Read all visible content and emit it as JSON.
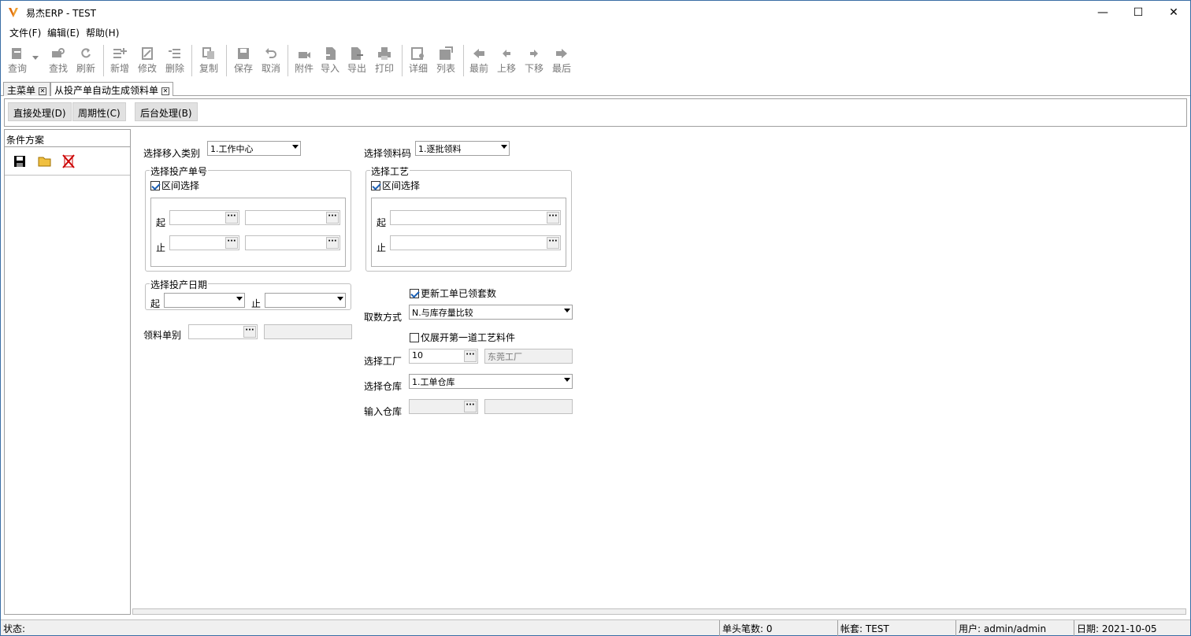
{
  "window": {
    "title": "易杰ERP - TEST",
    "minimize": "—",
    "maximize": "☐",
    "close": "✕"
  },
  "menu": [
    "文件(F)",
    "编辑(E)",
    "帮助(H)"
  ],
  "toolbar": {
    "query": "查询",
    "find": "查找",
    "refresh": "刷新",
    "add": "新增",
    "edit": "修改",
    "delete": "删除",
    "copy": "复制",
    "save": "保存",
    "cancel": "取消",
    "attach": "附件",
    "import": "导入",
    "export": "导出",
    "print": "打印",
    "detail": "详细",
    "list": "列表",
    "first": "最前",
    "up": "上移",
    "down": "下移",
    "last": "最后"
  },
  "tabs": [
    {
      "label": "主菜单"
    },
    {
      "label": "从投产单自动生成领料单"
    }
  ],
  "actions": {
    "direct": "直接处理(D)",
    "periodic": "周期性(C)",
    "background": "后台处理(B)"
  },
  "left_panel": {
    "header": "条件方案"
  },
  "form": {
    "move_type_label": "选择移入类别",
    "move_type_value": "1.工作中心",
    "pick_code_label": "选择领料码",
    "pick_code_value": "1.逐批领料",
    "order_group": "选择投产单号",
    "range_select": "区间选择",
    "from": "起",
    "to": "止",
    "process_group": "选择工艺",
    "date_group": "选择投产日期",
    "pick_doc_label": "领料单别",
    "update_check": "更新工单已领套数",
    "fetch_label": "取数方式",
    "fetch_value": "N.与库存量比较",
    "expand_check": "仅展开第一道工艺料件",
    "factory_label": "选择工厂",
    "factory_code": "10",
    "factory_name": "东莞工厂",
    "warehouse_label": "选择仓库",
    "warehouse_value": "1.工单仓库",
    "in_warehouse_label": "输入仓库"
  },
  "status": {
    "state": "状态:",
    "count": "单头笔数: 0",
    "account": "帐套: TEST",
    "user": "用户: admin/admin",
    "date": "日期: 2021-10-05"
  },
  "colors": {
    "accent": "#1a5fb4",
    "logo": "#f0a030"
  }
}
